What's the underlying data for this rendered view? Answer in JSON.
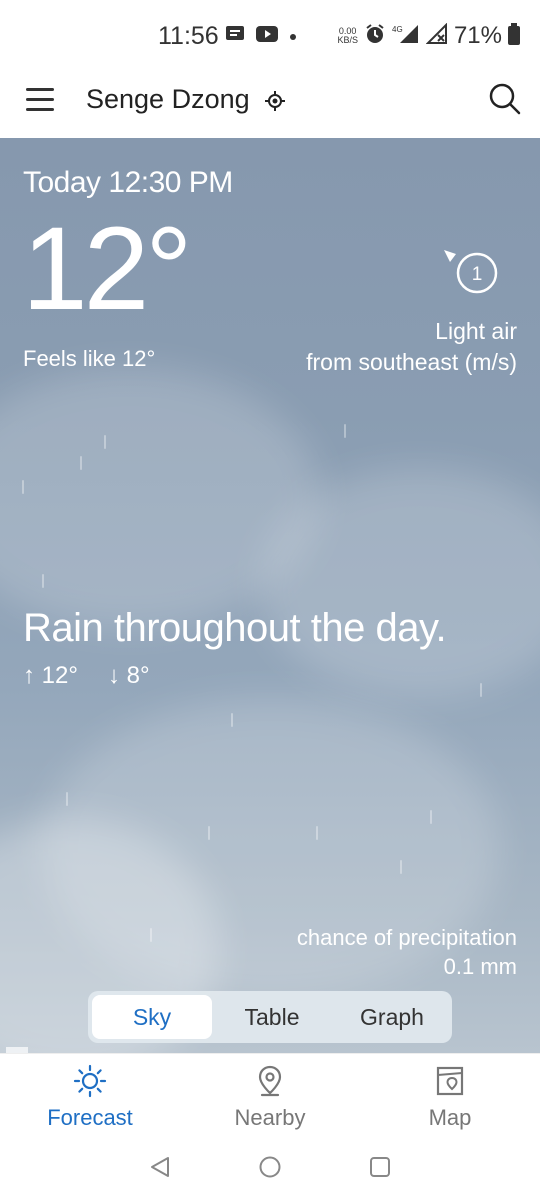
{
  "status_bar": {
    "time": "11:56",
    "net_speed_value": "0.00",
    "net_speed_unit": "KB/S",
    "network_type": "4G",
    "battery": "71%"
  },
  "app_bar": {
    "location": "Senge Dzong"
  },
  "weather": {
    "date_line": "Today 12:30 PM",
    "temperature": "12°",
    "feels_like": "Feels like 12°",
    "wind_speed": "1",
    "wind_desc_line1": "Light air",
    "wind_desc_line2": "from southeast (m/s)",
    "summary": "Rain throughout the day.",
    "high": "12°",
    "low": "8°",
    "precip_label": "chance of precipitation",
    "precip_value": "0.1 mm"
  },
  "view_tabs": [
    {
      "label": "Sky",
      "active": true
    },
    {
      "label": "Table",
      "active": false
    },
    {
      "label": "Graph",
      "active": false
    }
  ],
  "bottom_nav": {
    "forecast": "Forecast",
    "nearby": "Nearby",
    "map": "Map"
  },
  "colors": {
    "accent": "#1f6fc4",
    "inactive": "#777777"
  }
}
